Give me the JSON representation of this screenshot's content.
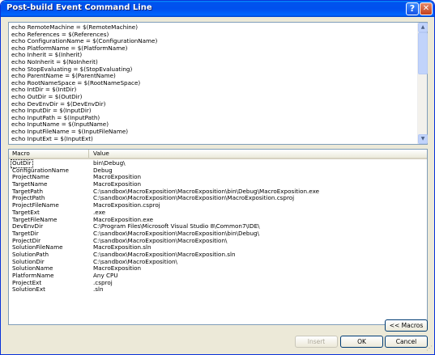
{
  "window": {
    "title": "Post-build Event Command Line",
    "help_label": "?",
    "close_label": "✕"
  },
  "editor": {
    "lines": [
      "echo RemoteMachine = $(RemoteMachine)",
      "echo References = $(References)",
      "echo ConfigurationName = $(ConfigurationName)",
      "echo PlatformName = $(PlatformName)",
      "echo Inherit = $(Inherit)",
      "echo NoInherit = $(NoInherit)",
      "echo StopEvaluating = $(StopEvaluating)",
      "echo ParentName = $(ParentName)",
      "echo RootNameSpace = $(RootNameSpace)",
      "echo IntDir = $(IntDir)",
      "echo OutDir = $(OutDir)",
      "echo DevEnvDir = $(DevEnvDir)",
      "echo InputDir = $(InputDir)",
      "echo InputPath = $(InputPath)",
      "echo InputName = $(InputName)",
      "echo InputFileName = $(InputFileName)",
      "echo InputExt = $(InputExt)"
    ]
  },
  "macros": {
    "columns": [
      "Macro",
      "Value"
    ],
    "rows": [
      {
        "name": "OutDir",
        "value": "bin\\Debug\\"
      },
      {
        "name": "ConfigurationName",
        "value": "Debug"
      },
      {
        "name": "ProjectName",
        "value": "MacroExposition"
      },
      {
        "name": "TargetName",
        "value": "MacroExposition"
      },
      {
        "name": "TargetPath",
        "value": "C:\\sandbox\\MacroExposition\\MacroExposition\\bin\\Debug\\MacroExposition.exe"
      },
      {
        "name": "ProjectPath",
        "value": "C:\\sandbox\\MacroExposition\\MacroExposition\\MacroExposition.csproj"
      },
      {
        "name": "ProjectFileName",
        "value": "MacroExposition.csproj"
      },
      {
        "name": "TargetExt",
        "value": ".exe"
      },
      {
        "name": "TargetFileName",
        "value": "MacroExposition.exe"
      },
      {
        "name": "DevEnvDir",
        "value": "C:\\Program Files\\Microsoft Visual Studio 8\\Common7\\IDE\\"
      },
      {
        "name": "TargetDir",
        "value": "C:\\sandbox\\MacroExposition\\MacroExposition\\bin\\Debug\\"
      },
      {
        "name": "ProjectDir",
        "value": "C:\\sandbox\\MacroExposition\\MacroExposition\\"
      },
      {
        "name": "SolutionFileName",
        "value": "MacroExposition.sln"
      },
      {
        "name": "SolutionPath",
        "value": "C:\\sandbox\\MacroExposition\\MacroExposition.sln"
      },
      {
        "name": "SolutionDir",
        "value": "C:\\sandbox\\MacroExposition\\"
      },
      {
        "name": "SolutionName",
        "value": "MacroExposition"
      },
      {
        "name": "PlatformName",
        "value": "Any CPU"
      },
      {
        "name": "ProjectExt",
        "value": ".csproj"
      },
      {
        "name": "SolutionExt",
        "value": ".sln"
      }
    ],
    "selected_index": 0
  },
  "buttons": {
    "macros_label": "<< Macros",
    "insert_label": "Insert",
    "ok_label": "OK",
    "cancel_label": "Cancel"
  },
  "scrollbar": {
    "up_glyph": "▲",
    "down_glyph": "▼"
  },
  "grip_glyph": "⋰",
  "colors": {
    "titlebar": "#0054e3",
    "dialog_face": "#ece9d8",
    "border": "#7f9db9",
    "scroll_thumb": "#c1d3fb"
  }
}
